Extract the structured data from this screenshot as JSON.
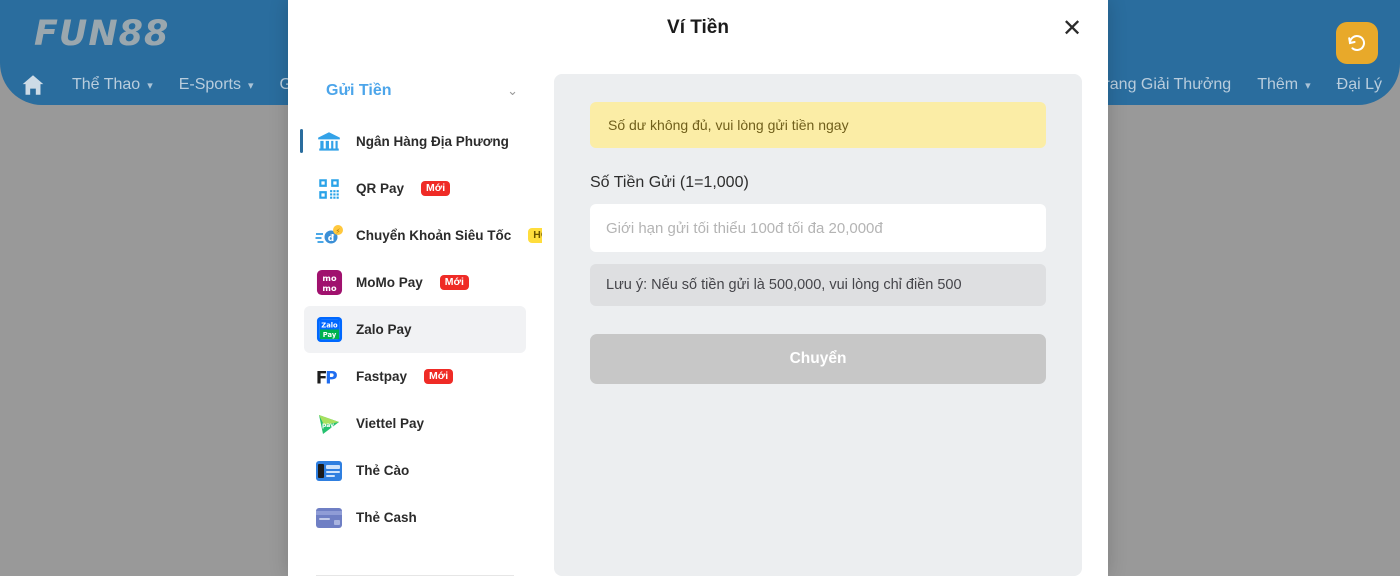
{
  "site": {
    "brand": "FUN88",
    "nav_left": [
      {
        "label": "Thể Thao",
        "caret": true
      },
      {
        "label": "E-Sports",
        "caret": true
      },
      {
        "label": "G",
        "caret": false
      }
    ],
    "nav_right": [
      {
        "label": "Trang Giải Thưởng",
        "caret": false
      },
      {
        "label": "Thêm",
        "caret": true
      },
      {
        "label": "Đại Lý",
        "caret": false
      }
    ],
    "home_icon": "home-icon",
    "refresh_icon": "history-refresh-icon",
    "colors": {
      "header_blue": "#2a6d9e",
      "backdrop": "#999999",
      "refresh_orange": "#e8a92a"
    }
  },
  "modal": {
    "title": "Ví Tiền",
    "close_label": "✕"
  },
  "sidebar": {
    "section_title": "Gửi Tiền",
    "caret": "⌄",
    "items": [
      {
        "label": "Ngân Hàng Địa Phương",
        "icon": "bank-icon",
        "badge": null,
        "active": false,
        "selected_bar": true
      },
      {
        "label": "QR Pay",
        "icon": "qr-code-icon",
        "badge": "Mới",
        "badge_type": "new",
        "active": false,
        "selected_bar": false
      },
      {
        "label": "Chuyển Khoản Siêu Tốc",
        "icon": "fast-transfer-icon",
        "badge": "HOT",
        "badge_type": "hot",
        "active": false,
        "selected_bar": false
      },
      {
        "label": "MoMo Pay",
        "icon": "momo-icon",
        "badge": "Mới",
        "badge_type": "new",
        "active": false,
        "selected_bar": false
      },
      {
        "label": "Zalo Pay",
        "icon": "zalopay-icon",
        "badge": null,
        "active": true,
        "selected_bar": false
      },
      {
        "label": "Fastpay",
        "icon": "fastpay-icon",
        "badge": "Mới",
        "badge_type": "new",
        "active": false,
        "selected_bar": false
      },
      {
        "label": "Viettel Pay",
        "icon": "viettelpay-icon",
        "badge": null,
        "active": false,
        "selected_bar": false
      },
      {
        "label": "Thẻ Cào",
        "icon": "scratch-card-icon",
        "badge": null,
        "active": false,
        "selected_bar": false
      },
      {
        "label": "Thẻ Cash",
        "icon": "cash-card-icon",
        "badge": null,
        "active": false,
        "selected_bar": false
      }
    ]
  },
  "main": {
    "alert": "Số dư không đủ, vui lòng gửi tiền ngay",
    "amount_label": "Số Tiền Gửi (1=1,000)",
    "amount_value": "",
    "amount_placeholder": "Giới hạn gửi tối thiểu 100đ tối đa 20,000đ",
    "hint": "Lưu ý: Nếu số tiền gửi là 500,000, vui lòng chỉ điền 500",
    "submit_label": "Chuyển"
  }
}
